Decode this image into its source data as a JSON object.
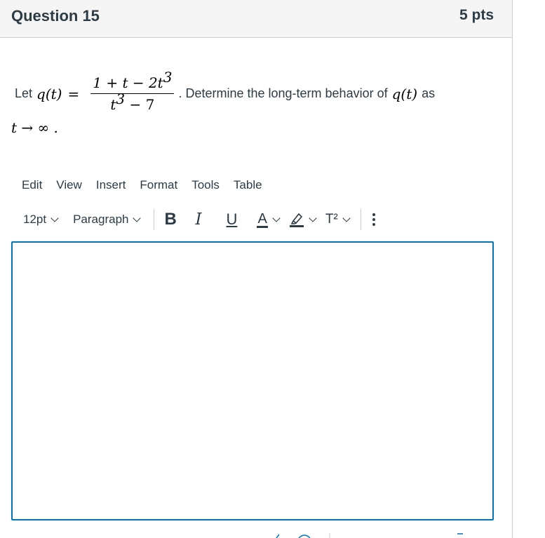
{
  "question": {
    "title": "Question 15",
    "points": "5 pts",
    "prefix": "Let",
    "func": "q(t)",
    "equals": "=",
    "numerator": {
      "a": "1 + t − 2t",
      "exp": "3"
    },
    "denominator": {
      "a": "t",
      "exp": "3",
      "b": " − 7"
    },
    "suffix_text": ". Determine the long-term  behavior of",
    "func2": "q(t)",
    "as": "as",
    "line2": "t → ∞ ."
  },
  "editor": {
    "menu": [
      "Edit",
      "View",
      "Insert",
      "Format",
      "Tools",
      "Table"
    ],
    "font_size": "12pt",
    "block_format": "Paragraph",
    "bold_label": "B",
    "italic_label": "I",
    "underline_label": "U",
    "text_color_label": "A",
    "superscript_label": "T²",
    "text_value": ""
  },
  "colors": {
    "accent": "#0374b5",
    "header_bg": "#f5f5f5",
    "text": "#2d3b45"
  },
  "icons": [
    "chevron-down-icon",
    "highlighter-icon",
    "more-vertical-icon"
  ]
}
